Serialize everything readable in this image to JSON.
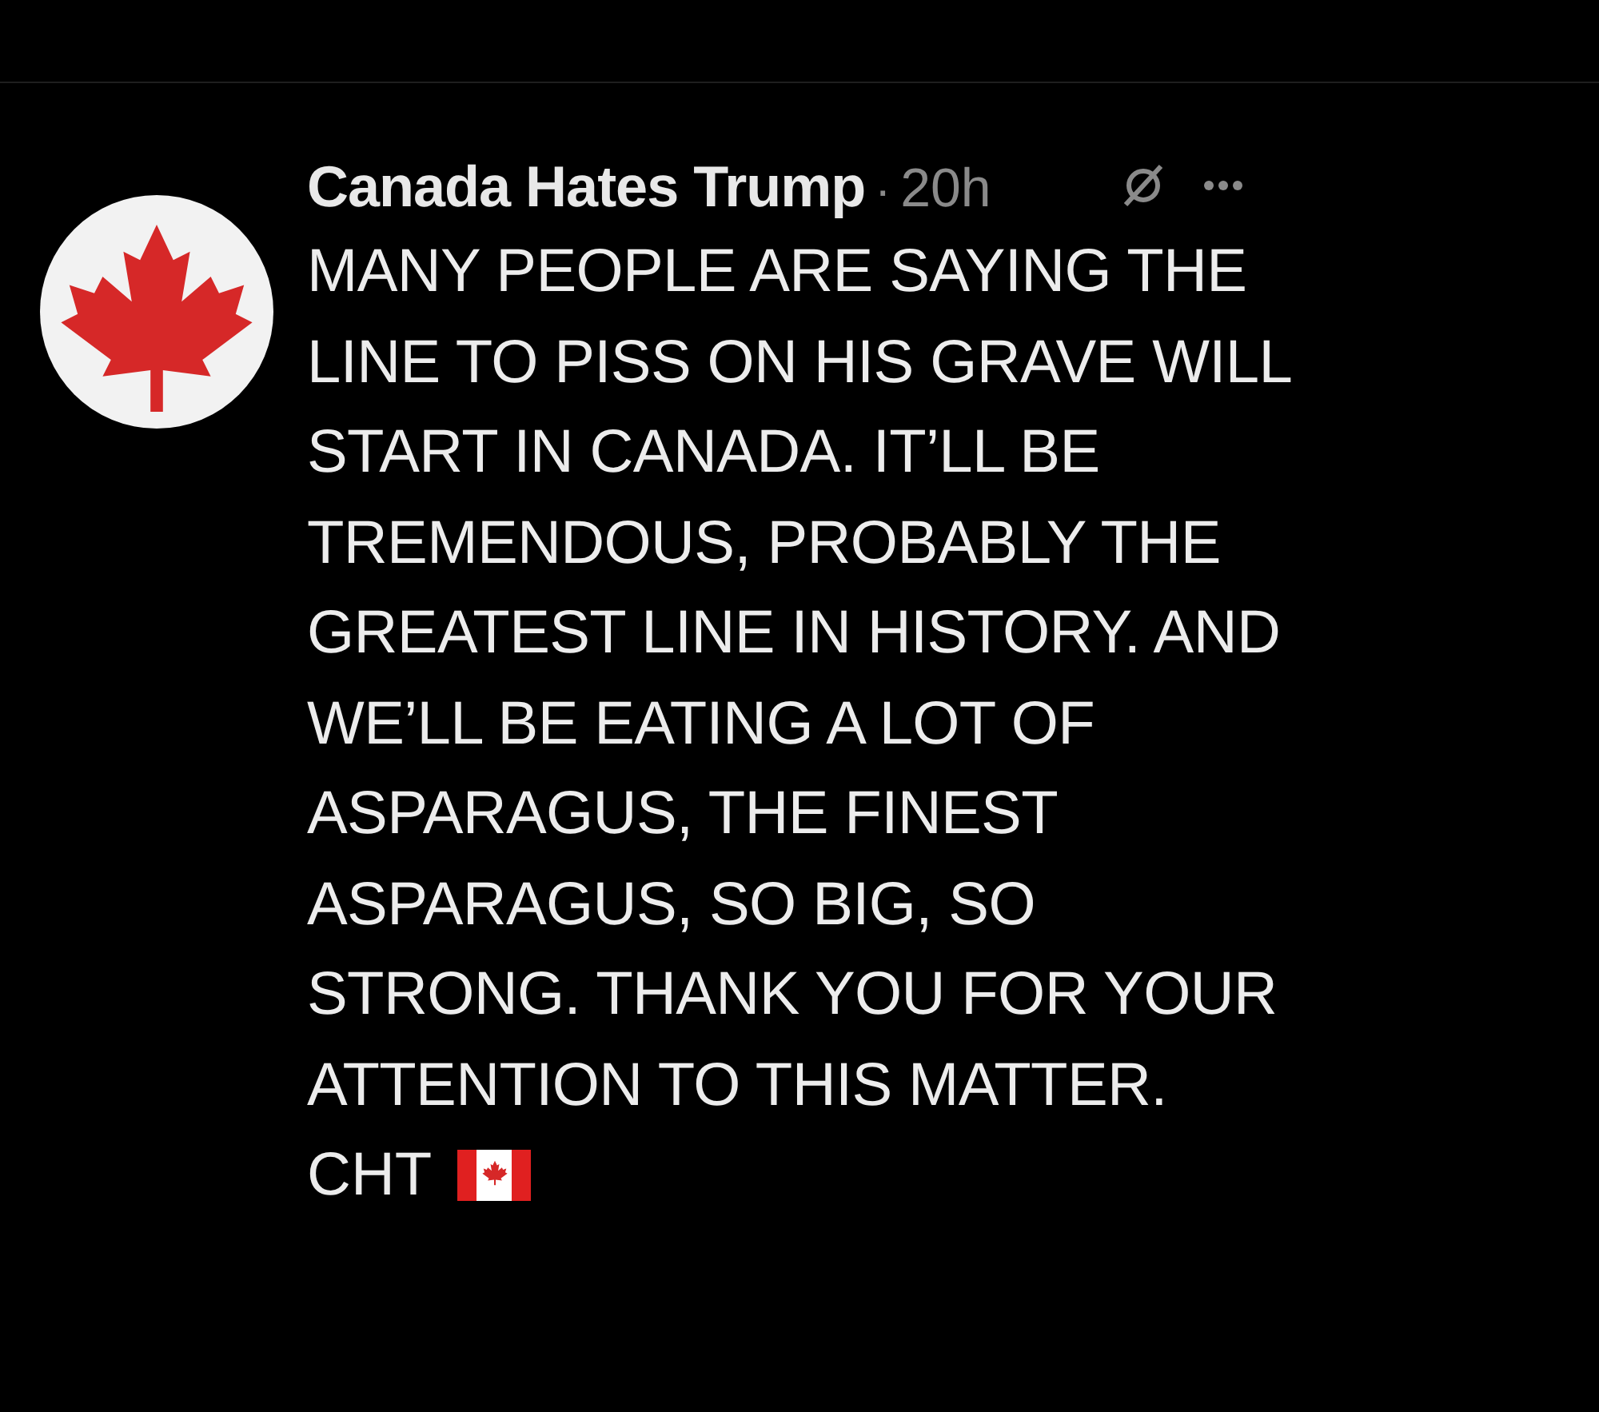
{
  "post": {
    "author": "Canada Hates Trump",
    "separator": "·",
    "time": "20h",
    "body": "MANY PEOPLE ARE SAYING THE\nLINE TO PISS ON HIS GRAVE WILL\nSTART IN CANADA. IT’LL BE\nTREMENDOUS, PROBABLY THE\nGREATEST LINE IN HISTORY. AND\nWE’LL BE EATING A LOT OF\nASPARAGUS, THE FINEST\nASPARAGUS, SO BIG, SO\nSTRONG. THANK YOU FOR YOUR\nATTENTION TO THIS MATTER.",
    "signature": "CHT"
  }
}
